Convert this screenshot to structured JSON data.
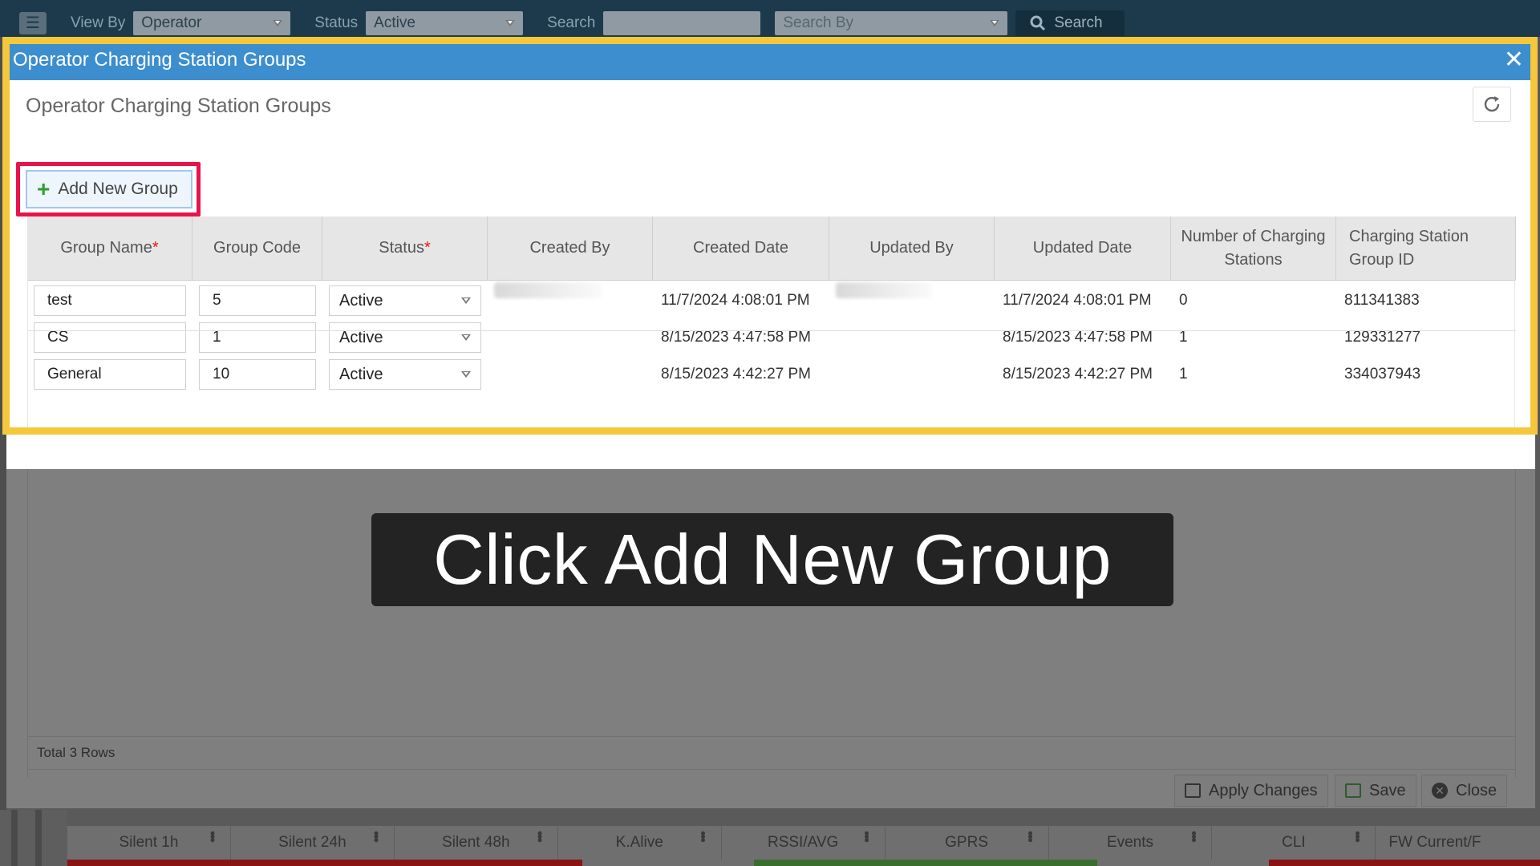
{
  "toolbar": {
    "view_by_label": "View By",
    "view_by_value": "Operator",
    "status_label": "Status",
    "status_value": "Active",
    "search_label": "Search",
    "search_by_placeholder": "Search By",
    "search_button": "Search"
  },
  "dialog": {
    "title": "Operator Charging Station Groups",
    "heading": "Operator Charging Station Groups",
    "add_button": "Add New Group",
    "columns": [
      {
        "label": "Group Name",
        "required": "*"
      },
      {
        "label": "Group Code",
        "required": ""
      },
      {
        "label": "Status",
        "required": "*"
      },
      {
        "label": "Created By",
        "required": ""
      },
      {
        "label": "Created Date",
        "required": ""
      },
      {
        "label": "Updated By",
        "required": ""
      },
      {
        "label": "Updated Date",
        "required": ""
      },
      {
        "label": "Number of Charging Stations",
        "required": ""
      },
      {
        "label": "Charging Station Group ID",
        "required": ""
      }
    ],
    "rows": [
      {
        "group_name": "test",
        "group_code": "5",
        "status": "Active",
        "created_date": "11/7/2024 4:08:01 PM",
        "updated_date": "11/7/2024 4:08:01 PM",
        "stations": "0",
        "group_id": "811341383"
      },
      {
        "group_name": "CS",
        "group_code": "1",
        "status": "Active",
        "created_date": "8/15/2023 4:47:58 PM",
        "updated_date": "8/15/2023 4:47:58 PM",
        "stations": "1",
        "group_id": "129331277"
      },
      {
        "group_name": "General",
        "group_code": "10",
        "status": "Active",
        "created_date": "8/15/2023 4:42:27 PM",
        "updated_date": "8/15/2023 4:42:27 PM",
        "stations": "1",
        "group_id": "334037943"
      }
    ],
    "total_rows": "Total 3 Rows",
    "apply_button": "Apply Changes",
    "save_button": "Save",
    "close_button": "Close"
  },
  "bottom_grid": {
    "headers": [
      "Silent 1h",
      "Silent 24h",
      "Silent 48h",
      "K.Alive",
      "RSSI/AVG",
      "GPRS",
      "Events",
      "CLI",
      "FW Current/F"
    ]
  },
  "caption": "Click Add New Group",
  "colors": {
    "titlebar": "#3c8ecf",
    "highlight_frame": "#f5c73b",
    "button_highlight": "#e8134a",
    "required": "#e01b1b"
  }
}
